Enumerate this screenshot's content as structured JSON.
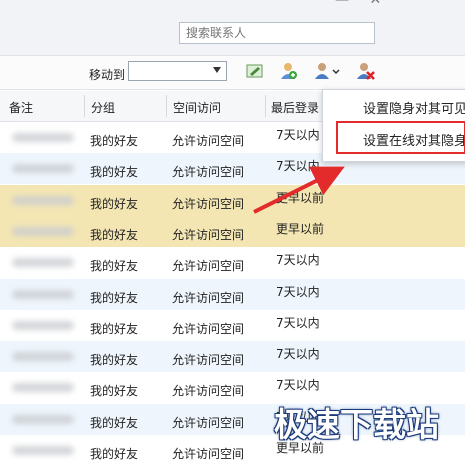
{
  "search": {
    "placeholder": "搜索联系人"
  },
  "toolbar": {
    "move_to_label": "移动到",
    "select_value": "",
    "icons": [
      "edit-icon",
      "add-contact-icon",
      "contact-options-icon",
      "delete-contact-icon"
    ]
  },
  "table": {
    "headers": [
      "备注",
      "分组",
      "空间访问",
      "最后登录"
    ],
    "rows": [
      {
        "group": "我的好友",
        "access": "允许访问空间",
        "last": "7天以内",
        "highlight": false,
        "alt": false
      },
      {
        "group": "我的好友",
        "access": "允许访问空间",
        "last": "7天以内",
        "highlight": false,
        "alt": true
      },
      {
        "group": "我的好友",
        "access": "允许访问空间",
        "last": "更早以前",
        "highlight": true,
        "alt": false
      },
      {
        "group": "我的好友",
        "access": "允许访问空间",
        "last": "更早以前",
        "highlight": true,
        "alt": false
      },
      {
        "group": "我的好友",
        "access": "允许访问空间",
        "last": "7天以内",
        "highlight": false,
        "alt": false
      },
      {
        "group": "我的好友",
        "access": "允许访问空间",
        "last": "7天以内",
        "highlight": false,
        "alt": true
      },
      {
        "group": "我的好友",
        "access": "允许访问空间",
        "last": "7天以内",
        "highlight": false,
        "alt": false
      },
      {
        "group": "我的好友",
        "access": "允许访问空间",
        "last": "7天以内",
        "highlight": false,
        "alt": true
      },
      {
        "group": "我的好友",
        "access": "允许访问空间",
        "last": "7天以内",
        "highlight": false,
        "alt": false
      },
      {
        "group": "我的好友",
        "access": "允许访问空间",
        "last": "7天以内",
        "highlight": false,
        "alt": true
      },
      {
        "group": "我的好友",
        "access": "允许访问空间",
        "last": "更早以前",
        "highlight": false,
        "alt": false
      }
    ]
  },
  "context_menu": {
    "items": [
      "设置隐身对其可见",
      "设置在线对其隐身"
    ]
  },
  "watermark": "极速下载站",
  "colors": {
    "highlight_row": "#f3e6b3",
    "alt_row": "#eef5fc",
    "annotation_red": "#e32b2b"
  }
}
